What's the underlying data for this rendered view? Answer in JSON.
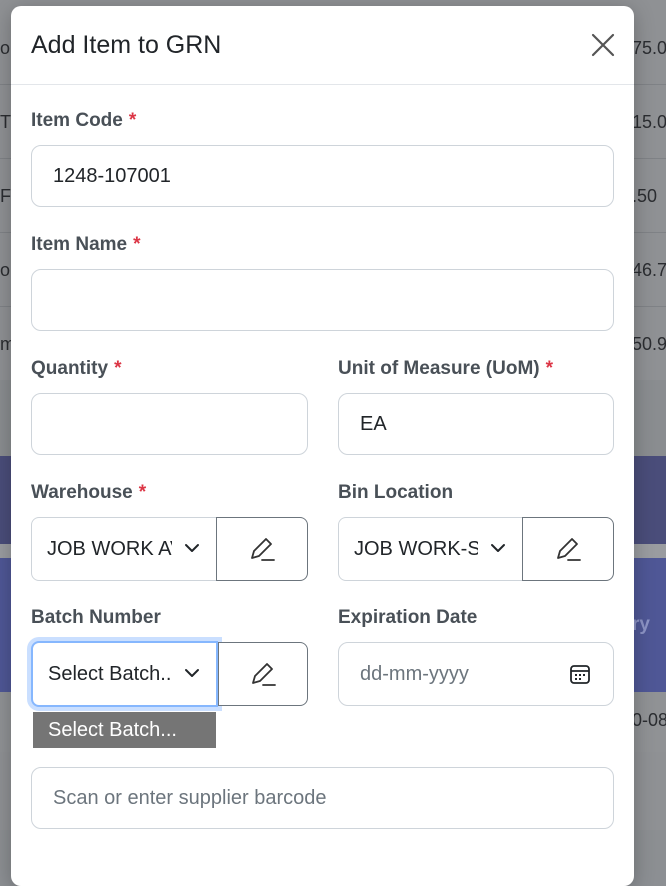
{
  "background": {
    "right_values": [
      "75.0",
      "15.0",
      ".50",
      "46.7",
      "50.9",
      "ry",
      "0-08-"
    ],
    "left_fragments": [
      "o",
      "T I",
      "Fr",
      "ol",
      "m"
    ]
  },
  "modal": {
    "title": "Add Item to GRN",
    "close_icon": "close-icon"
  },
  "form": {
    "item_code": {
      "label": "Item Code",
      "required": "*",
      "value": "1248-107001"
    },
    "item_name": {
      "label": "Item Name",
      "required": "*",
      "value": ""
    },
    "quantity": {
      "label": "Quantity",
      "required": "*",
      "value": ""
    },
    "uom": {
      "label": "Unit of Measure (UoM)",
      "required": "*",
      "value": "EA"
    },
    "warehouse": {
      "label": "Warehouse",
      "required": "*",
      "value": "JOB WORK AV"
    },
    "bin_location": {
      "label": "Bin Location",
      "value": "JOB WORK-SY"
    },
    "batch_number": {
      "label": "Batch Number",
      "value": "Select Batch...",
      "options": [
        "Select Batch..."
      ]
    },
    "expiration_date": {
      "label": "Expiration Date",
      "placeholder": "dd-mm-yyyy"
    },
    "supplier_barcode": {
      "placeholder": "Scan or enter supplier barcode"
    }
  },
  "colors": {
    "required": "#dc3545",
    "focus": "#86b7fe",
    "dropdown_bg": "#757575"
  }
}
